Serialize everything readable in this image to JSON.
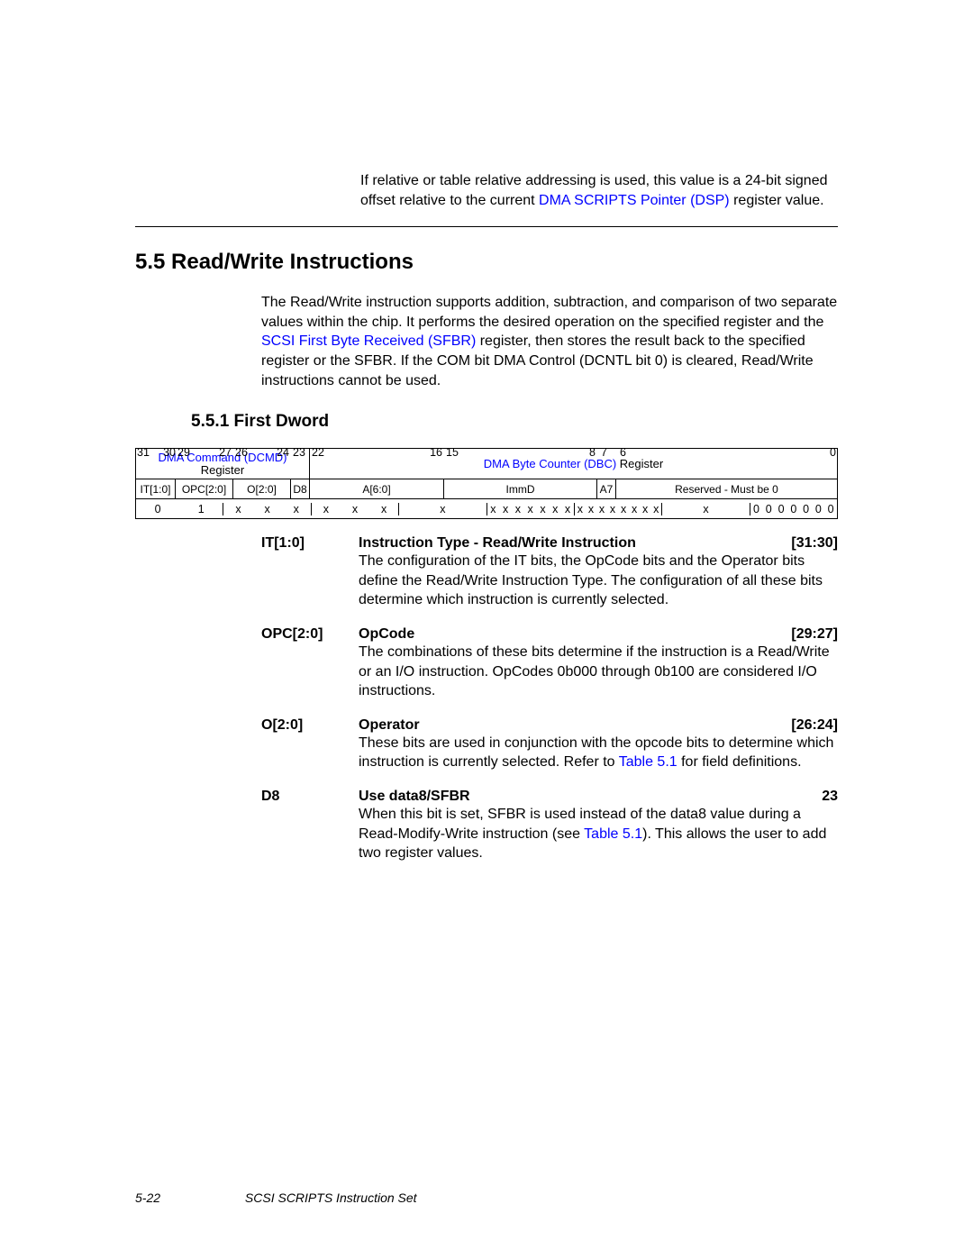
{
  "intro_para": {
    "pre": "If relative or table relative addressing is used, this value is a 24-bit signed offset relative to the current ",
    "link": "DMA SCRIPTS Pointer (DSP)",
    "post": " register value."
  },
  "section_heading": "5.5  Read/Write Instructions",
  "section_para": {
    "t1": "The Read/Write instruction supports addition, subtraction, and comparison of two separate values within the chip. It performs the desired operation on the specified register and the ",
    "link1": "SCSI First Byte Received (SFBR)",
    "t2": " register, then stores the result back to the specified register or the SFBR. If the COM bit DMA Control (DCNTL bit 0) is cleared, Read/Write instructions cannot be used."
  },
  "subsection_heading": "5.5.1  First Dword",
  "bit_numbers": {
    "n31": "31",
    "n30": "30",
    "n29": "29",
    "n27": "27",
    "n26": "26",
    "n24": "24",
    "n23": "23",
    "n22": "22",
    "n16": "16",
    "n15": "15",
    "n8": "8",
    "n7": "7",
    "n6": "6",
    "n0": "0"
  },
  "row_titles": {
    "dcmd_link": "DMA Command (DCMD)",
    "dcmd_reg": "Register",
    "dbc_link": "DMA Byte Counter (DBC)",
    "dbc_reg": " Register"
  },
  "row_fields": {
    "it": "IT[1:0]",
    "opc": "OPC[2:0]",
    "o": "O[2:0]",
    "d8": "D8",
    "a": "A[6:0]",
    "immd": "ImmD",
    "a7": "A7",
    "res": "Reserved - Must be 0"
  },
  "row_values": {
    "b0": "0",
    "b1": "1",
    "x": "x",
    "z": "0"
  },
  "fields": [
    {
      "label": "IT[1:0]",
      "title": "Instruction Type - Read/Write Instruction",
      "range": "[31:30]",
      "desc_plain": "The configuration of the IT bits, the OpCode bits and the Operator bits define the Read/Write Instruction Type. The configuration of all these bits determine which instruction is currently selected."
    },
    {
      "label": "OPC[2:0]",
      "title": "OpCode",
      "range": "[29:27]",
      "desc_plain": "The combinations of these bits determine if the instruction is a Read/Write or an I/O instruction. OpCodes 0b000 through 0b100 are considered I/O instructions."
    },
    {
      "label": "O[2:0]",
      "title": "Operator",
      "range": "[26:24]",
      "desc_pre": "These bits are used in conjunction with the opcode bits to determine which instruction is currently selected. Refer to ",
      "desc_link": "Table 5.1",
      "desc_post": " for field definitions."
    },
    {
      "label": "D8",
      "title": "Use data8/SFBR",
      "range": "23",
      "desc_pre": "When this bit is set, SFBR is used instead of the data8 value during a Read-Modify-Write instruction (see ",
      "desc_link": "Table 5.1",
      "desc_post": "). This allows the user to add two register values."
    }
  ],
  "footer": {
    "page": "5-22",
    "doc": "SCSI SCRIPTS Instruction Set"
  }
}
